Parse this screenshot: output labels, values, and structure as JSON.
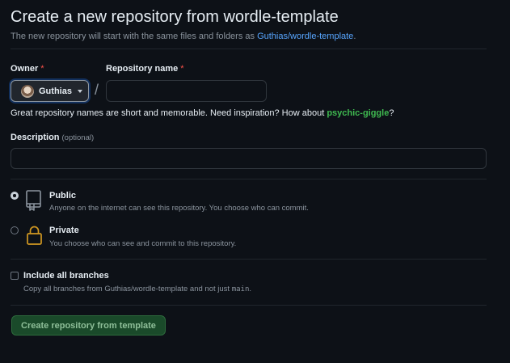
{
  "header": {
    "title": "Create a new repository from wordle-template",
    "subtitle_prefix": "The new repository will start with the same files and folders as ",
    "template_link": "Guthias/wordle-template",
    "subtitle_suffix": "."
  },
  "owner": {
    "label": "Owner",
    "required_mark": "*",
    "value": "Guthias"
  },
  "repo_name": {
    "label": "Repository name",
    "required_mark": "*",
    "value": ""
  },
  "separator": "/",
  "hint": {
    "prefix": "Great repository names are short and memorable. Need inspiration? How about ",
    "suggestion": "psychic-giggle",
    "suffix": "?"
  },
  "description": {
    "label": "Description",
    "optional": "(optional)",
    "value": ""
  },
  "visibility": {
    "public": {
      "title": "Public",
      "desc": "Anyone on the internet can see this repository. You choose who can commit.",
      "checked": true
    },
    "private": {
      "title": "Private",
      "desc": "You choose who can see and commit to this repository.",
      "checked": false
    }
  },
  "branches": {
    "title": "Include all branches",
    "desc_prefix": "Copy all branches from Guthias/wordle-template and not just ",
    "desc_code": "main",
    "desc_suffix": ".",
    "checked": false
  },
  "submit_label": "Create repository from template",
  "colors": {
    "background": "#0d1117",
    "link": "#58a6ff",
    "suggestion": "#3fb950",
    "required": "#f85149",
    "lock_icon": "#d29922",
    "submit_bg": "#1a4a2a"
  }
}
